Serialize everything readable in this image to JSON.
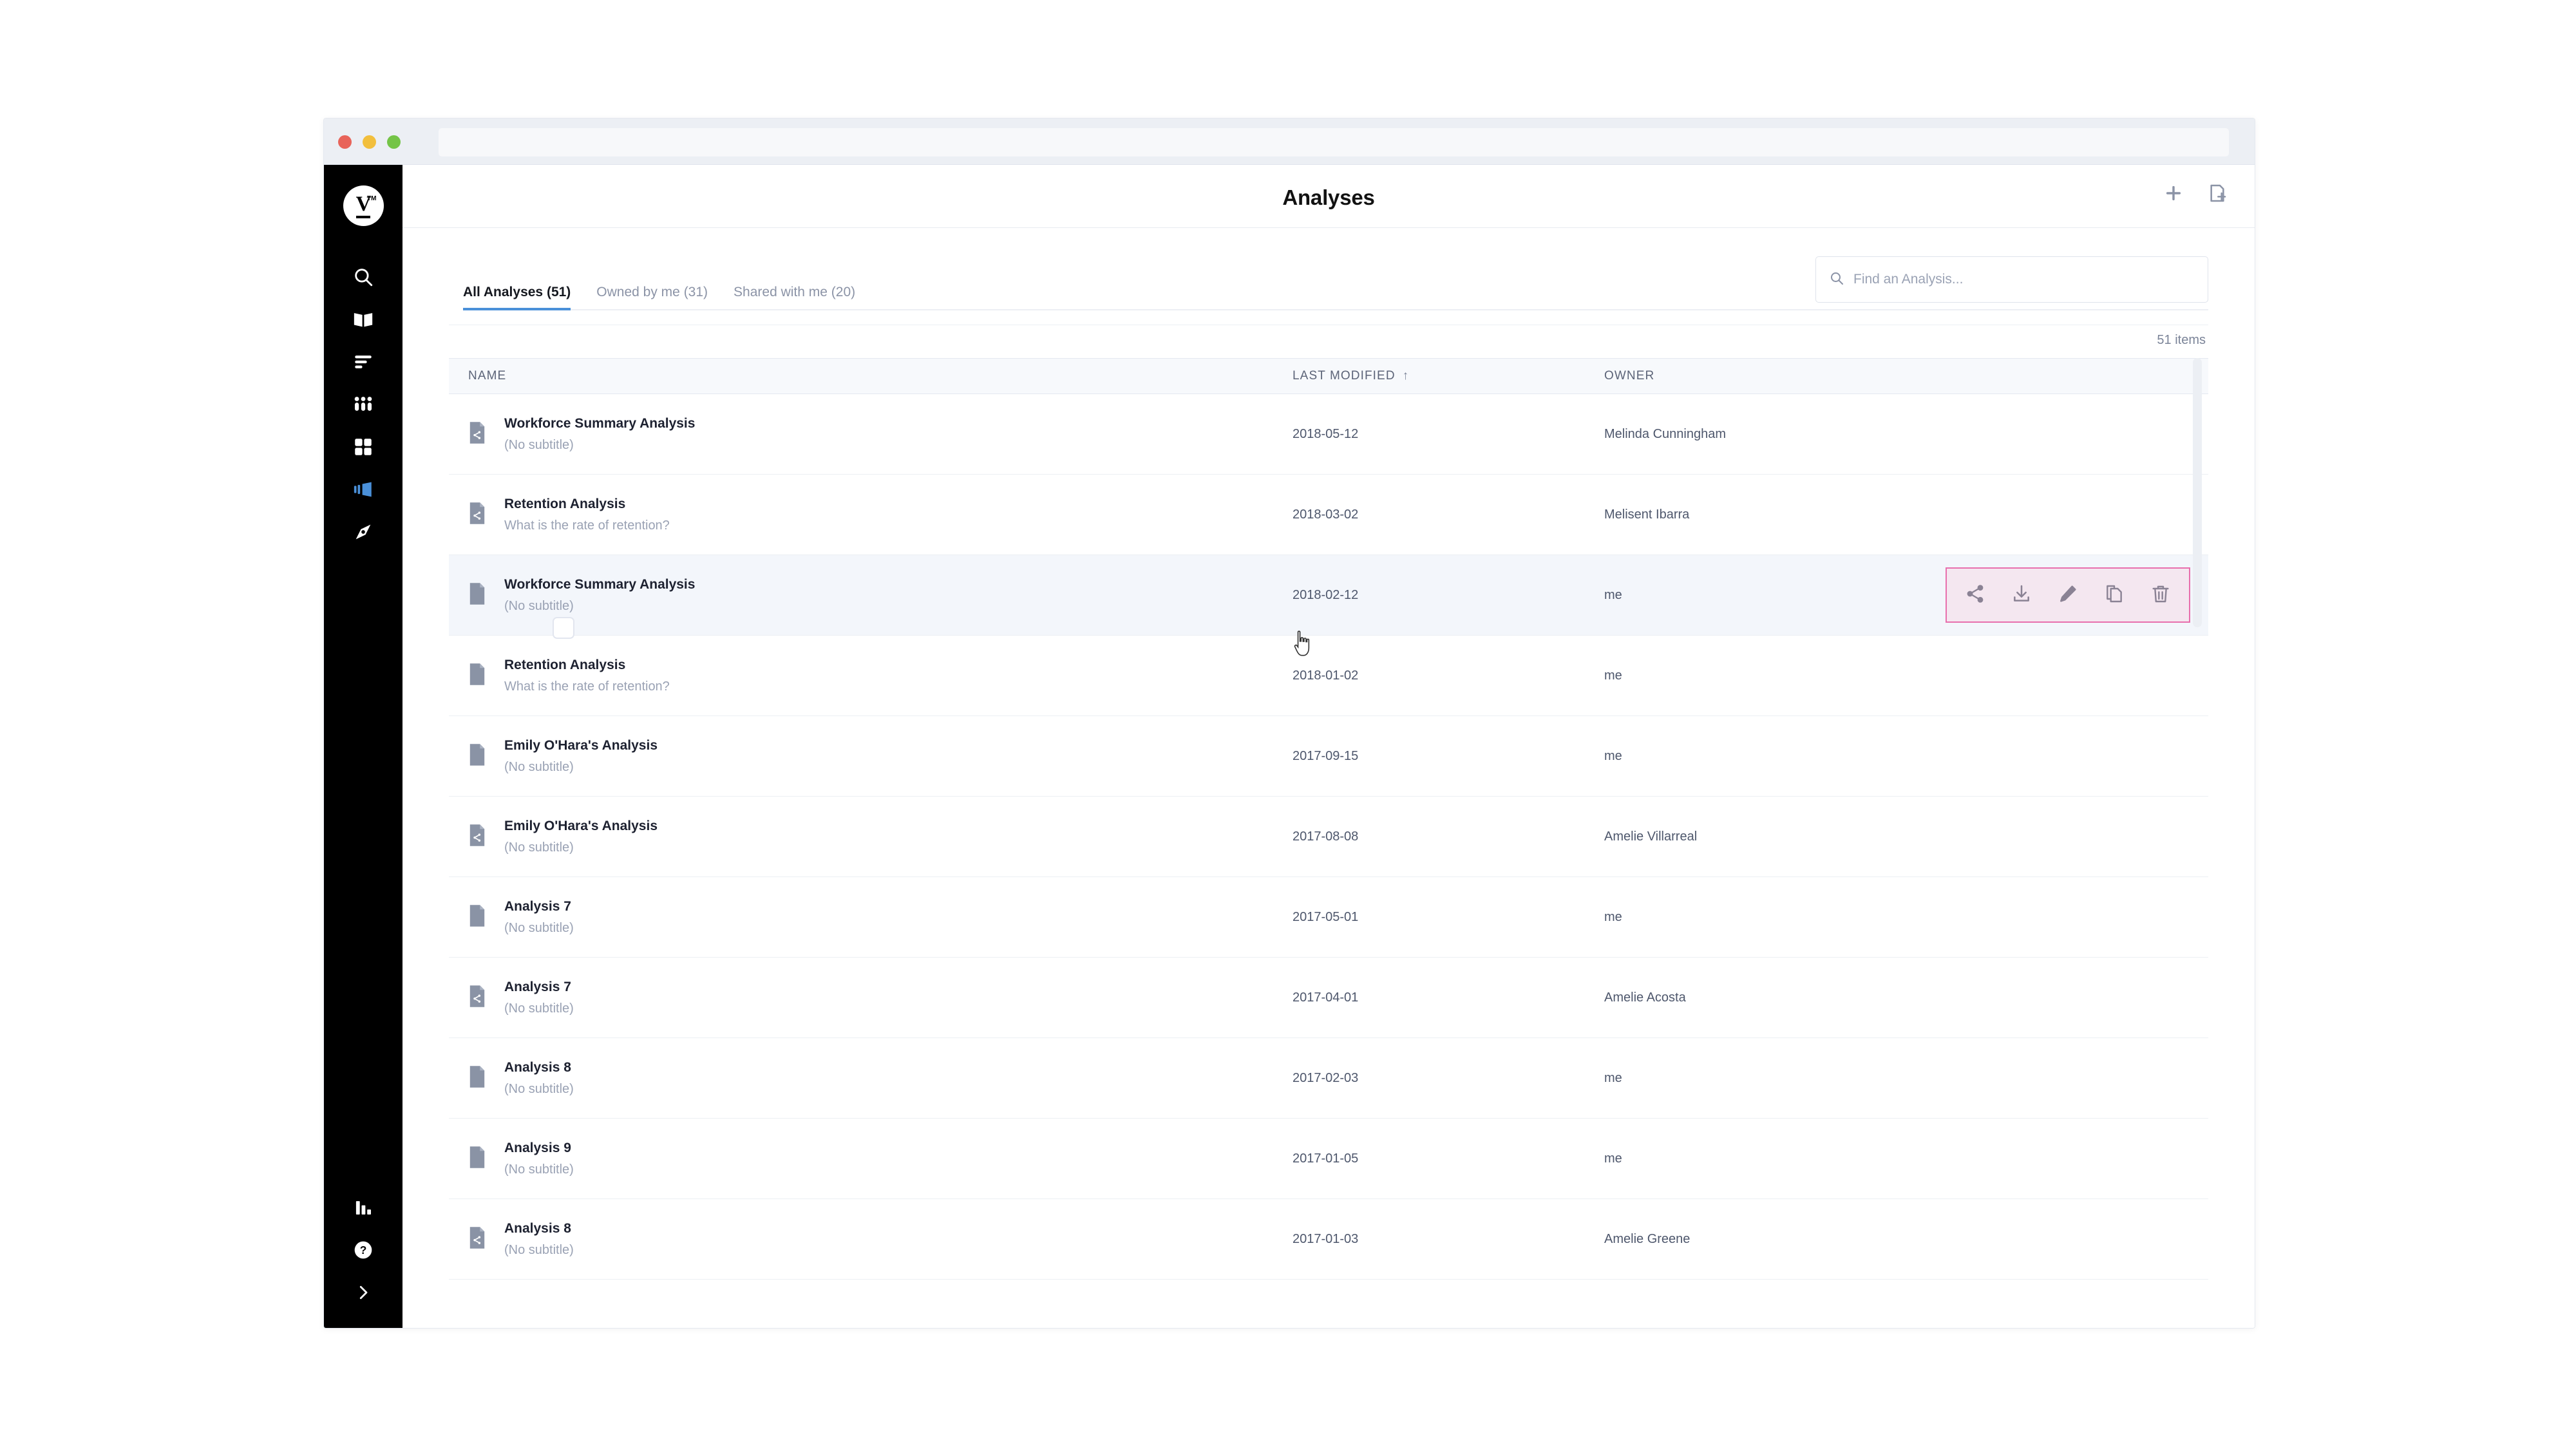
{
  "window": {
    "traffic_lights": [
      "close-red",
      "minimize-yellow",
      "maximize-green"
    ],
    "url_value": ""
  },
  "sidebar": {
    "logo": {
      "letter": "V",
      "trademark": "TM"
    },
    "items": [
      {
        "name": "search",
        "icon": "search-icon",
        "active": false
      },
      {
        "name": "library",
        "icon": "book-icon",
        "active": false
      },
      {
        "name": "metrics",
        "icon": "bar-list-icon",
        "active": false
      },
      {
        "name": "people",
        "icon": "people-group-icon",
        "active": false
      },
      {
        "name": "apps",
        "icon": "grid-icon",
        "active": false
      },
      {
        "name": "analyses",
        "icon": "analyses-icon",
        "active": true
      },
      {
        "name": "explore",
        "icon": "compass-icon",
        "active": false
      }
    ],
    "bottom_items": [
      {
        "name": "reports",
        "icon": "bar-chart-icon"
      },
      {
        "name": "help",
        "icon": "help-circle-icon"
      },
      {
        "name": "expand",
        "icon": "chevron-right-icon"
      }
    ],
    "accent_color": "#4a90d9"
  },
  "header": {
    "title": "Analyses",
    "actions": [
      {
        "name": "add",
        "icon": "plus-icon"
      },
      {
        "name": "new-analysis",
        "icon": "new-document-icon"
      }
    ]
  },
  "tabs": [
    {
      "label": "All Analyses (51)",
      "active": true
    },
    {
      "label": "Owned by me (31)",
      "active": false
    },
    {
      "label": "Shared with me (20)",
      "active": false
    }
  ],
  "search": {
    "placeholder": "Find an Analysis...",
    "value": "",
    "icon": "search-icon"
  },
  "items_count": "51 items",
  "table": {
    "columns": [
      {
        "key": "name",
        "label": "NAME",
        "sorted": false
      },
      {
        "key": "date",
        "label": "LAST MODIFIED",
        "sorted": true,
        "sort_dir": "↑"
      },
      {
        "key": "owner",
        "label": "OWNER",
        "sorted": false
      }
    ],
    "rows": [
      {
        "title": "Workforce Summary Analysis",
        "subtitle": "(No subtitle)",
        "date": "2018-05-12",
        "owner": "Melinda Cunningham",
        "icon": "shared-document-icon",
        "hovered": false
      },
      {
        "title": "Retention Analysis",
        "subtitle": "What is the rate of retention?",
        "date": "2018-03-02",
        "owner": "Melisent Ibarra",
        "icon": "shared-document-icon",
        "hovered": false
      },
      {
        "title": "Workforce Summary Analysis",
        "subtitle": "(No subtitle)",
        "date": "2018-02-12",
        "owner": "me",
        "icon": "document-icon",
        "hovered": true
      },
      {
        "title": "Retention Analysis",
        "subtitle": "What is the rate of retention?",
        "date": "2018-01-02",
        "owner": "me",
        "icon": "document-icon",
        "hovered": false
      },
      {
        "title": "Emily O'Hara's Analysis",
        "subtitle": "(No subtitle)",
        "date": "2017-09-15",
        "owner": "me",
        "icon": "document-icon",
        "hovered": false
      },
      {
        "title": "Emily O'Hara's Analysis",
        "subtitle": "(No subtitle)",
        "date": "2017-08-08",
        "owner": "Amelie Villarreal",
        "icon": "shared-document-icon",
        "hovered": false
      },
      {
        "title": "Analysis 7",
        "subtitle": "(No subtitle)",
        "date": "2017-05-01",
        "owner": "me",
        "icon": "document-icon",
        "hovered": false
      },
      {
        "title": "Analysis 7",
        "subtitle": "(No subtitle)",
        "date": "2017-04-01",
        "owner": "Amelie Acosta",
        "icon": "shared-document-icon",
        "hovered": false
      },
      {
        "title": "Analysis 8",
        "subtitle": "(No subtitle)",
        "date": "2017-02-03",
        "owner": "me",
        "icon": "document-icon",
        "hovered": false
      },
      {
        "title": "Analysis 9",
        "subtitle": "(No subtitle)",
        "date": "2017-01-05",
        "owner": "me",
        "icon": "document-icon",
        "hovered": false
      },
      {
        "title": "Analysis 8",
        "subtitle": "(No subtitle)",
        "date": "2017-01-03",
        "owner": "Amelie Greene",
        "icon": "shared-document-icon",
        "hovered": false
      }
    ]
  },
  "row_actions": [
    {
      "name": "share",
      "icon": "share-icon"
    },
    {
      "name": "download",
      "icon": "download-icon"
    },
    {
      "name": "edit",
      "icon": "pencil-icon"
    },
    {
      "name": "duplicate",
      "icon": "copy-icon"
    },
    {
      "name": "delete",
      "icon": "trash-icon"
    }
  ],
  "colors": {
    "accent": "#4a90d9",
    "sidebar_bg": "#000000",
    "row_hover": "#f3f6fb",
    "actions_border": "#e86fad",
    "actions_bg": "#f4e7f0",
    "header_bg": "#f7f9fc"
  }
}
